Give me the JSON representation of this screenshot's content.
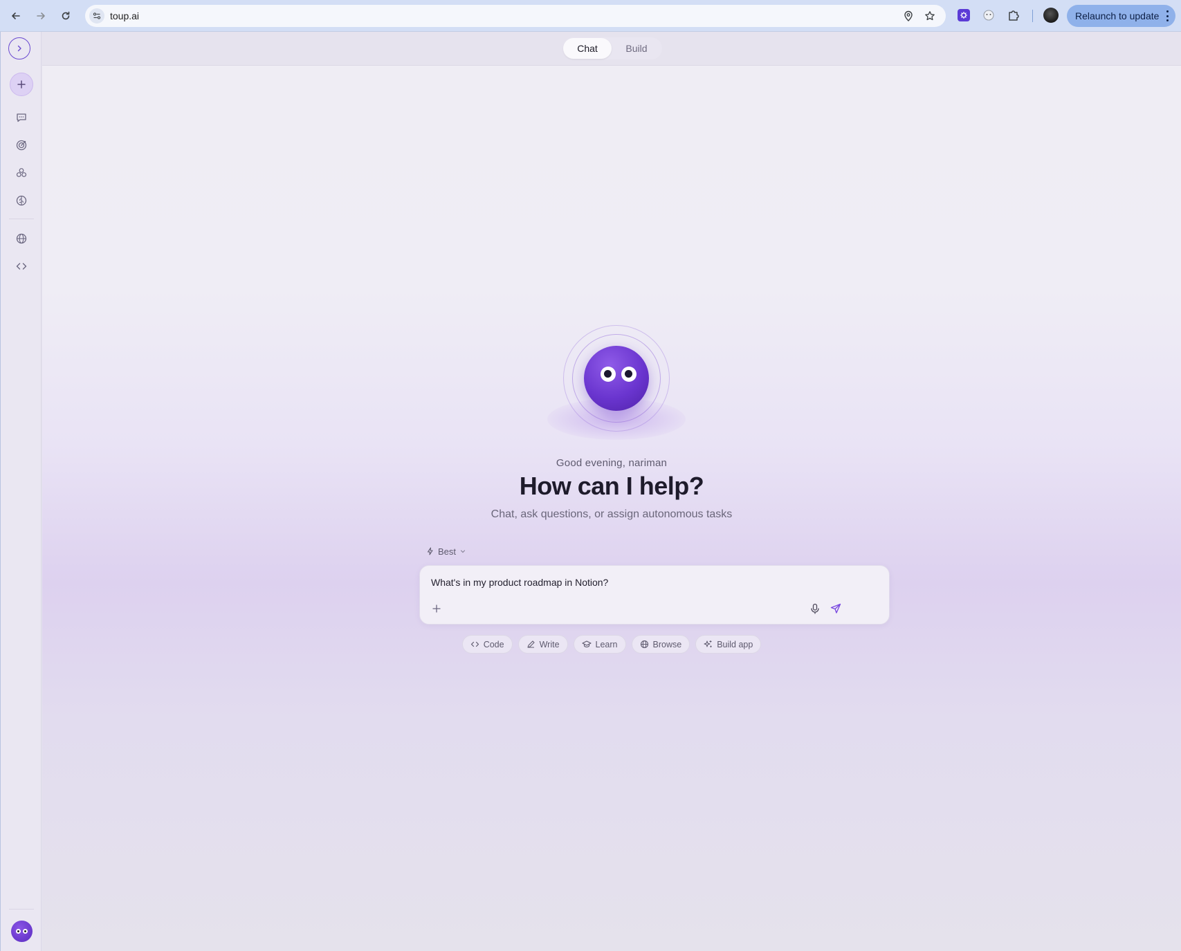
{
  "browser": {
    "url": "toup.ai",
    "relaunch_label": "Relaunch to update"
  },
  "topbar": {
    "tabs": [
      {
        "label": "Chat",
        "active": true
      },
      {
        "label": "Build",
        "active": false
      }
    ]
  },
  "hero": {
    "greeting": "Good evening, nariman",
    "headline": "How can I help?",
    "subheadline": "Chat, ask questions, or assign autonomous tasks"
  },
  "composer": {
    "model_label": "Best",
    "prompt_text": "What's in my product roadmap in Notion?"
  },
  "chips": [
    {
      "label": "Code",
      "icon": "code-icon"
    },
    {
      "label": "Write",
      "icon": "pen-icon"
    },
    {
      "label": "Learn",
      "icon": "graduation-cap-icon"
    },
    {
      "label": "Browse",
      "icon": "globe-icon"
    },
    {
      "label": "Build app",
      "icon": "sparkles-icon"
    }
  ],
  "sidebar": {
    "items": [
      {
        "icon": "chevron-right-icon"
      },
      {
        "icon": "plus-icon"
      },
      {
        "icon": "chat-bubble-icon"
      },
      {
        "icon": "target-icon"
      },
      {
        "icon": "apps-cluster-icon"
      },
      {
        "icon": "brain-icon"
      },
      {
        "icon": "globe-icon"
      },
      {
        "icon": "code-icon"
      }
    ]
  },
  "colors": {
    "accent": "#6a35cf",
    "relaunch_bg": "#8fb1ea",
    "browser_bar": "#d3def5"
  }
}
